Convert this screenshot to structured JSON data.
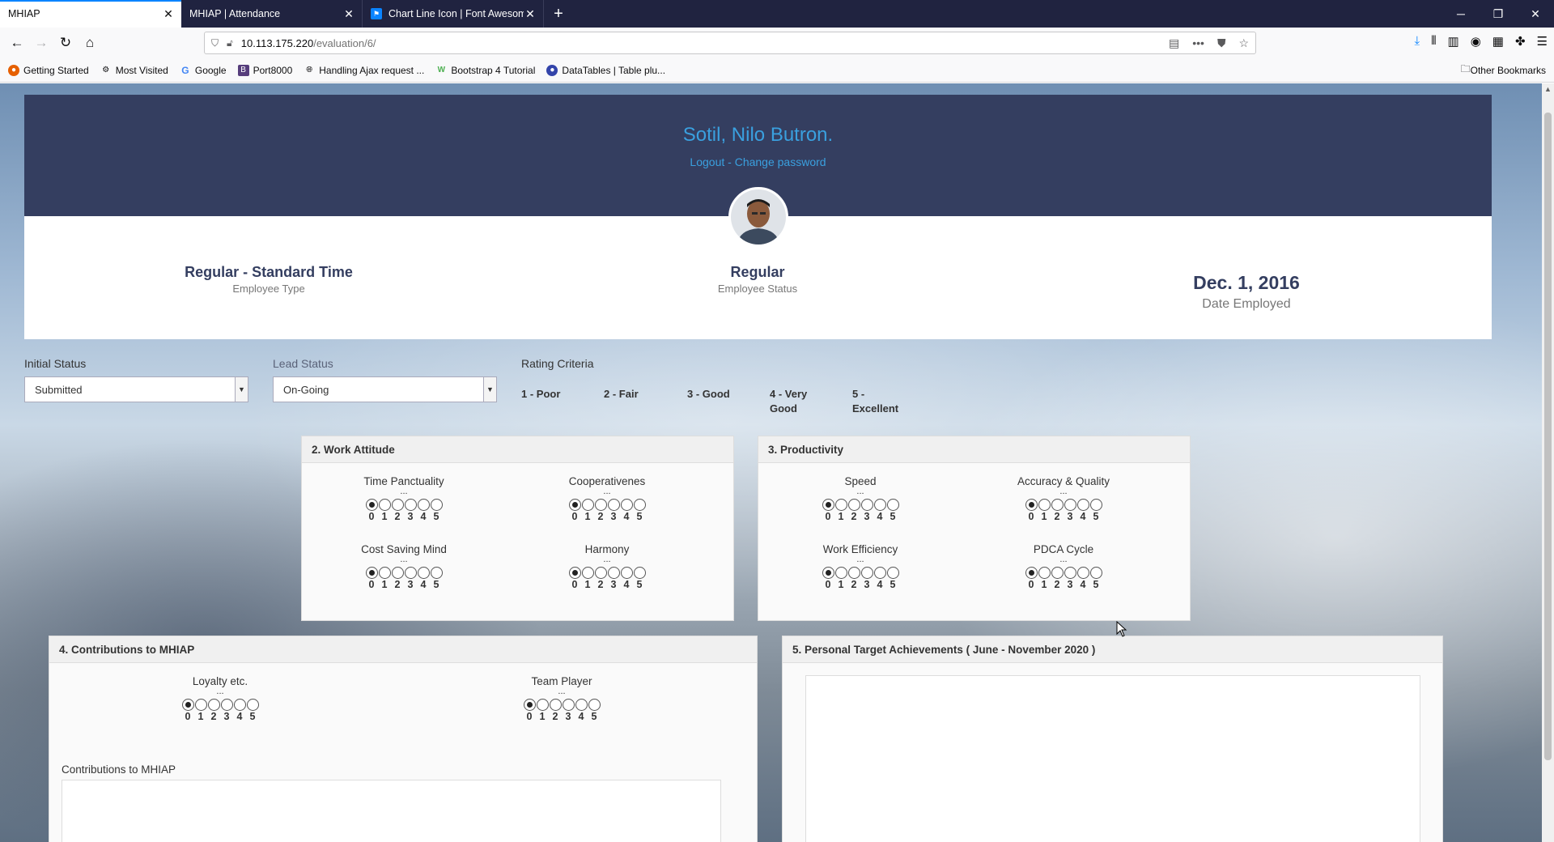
{
  "browser": {
    "tabs": [
      {
        "title": "MHIAP",
        "active": true
      },
      {
        "title": "MHIAP | Attendance",
        "active": false
      },
      {
        "title": "Chart Line Icon | Font Awesom",
        "active": false
      }
    ],
    "url_host": "10.113.175.220",
    "url_path": "/evaluation/6/",
    "bookmarks": [
      "Getting Started",
      "Most Visited",
      "Google",
      "Port8000",
      "Handling Ajax request ...",
      "Bootstrap 4 Tutorial",
      "DataTables | Table plu..."
    ],
    "other_bookmarks": "Other Bookmarks"
  },
  "header": {
    "employee_name": "Sotil, Nilo Butron.",
    "logout": "Logout",
    "separator": " - ",
    "change_password": "Change password"
  },
  "info": {
    "employee_type": "Regular - Standard Time",
    "employee_type_label": "Employee Type",
    "employee_status": "Regular",
    "employee_status_label": "Employee Status",
    "date_employed": "Dec. 1, 2016",
    "date_employed_label": "Date Employed"
  },
  "filters": {
    "initial_status_label": "Initial Status",
    "initial_status_value": "Submitted",
    "lead_status_label": "Lead Status",
    "lead_status_value": "On-Going"
  },
  "criteria": {
    "title": "Rating Criteria",
    "items": [
      "1 - Poor",
      "2 - Fair",
      "3 - Good",
      "4 - Very Good",
      "5 - Excellent"
    ]
  },
  "rating_scale": [
    "0",
    "1",
    "2",
    "3",
    "4",
    "5"
  ],
  "sections": {
    "work_attitude": {
      "title": "2. Work Attitude",
      "metrics": [
        {
          "name": "Time Panctuality",
          "dots": "...",
          "selected": 0
        },
        {
          "name": "Cooperativenes",
          "dots": "...",
          "selected": 0
        },
        {
          "name": "Cost Saving Mind",
          "dots": "...",
          "selected": 0
        },
        {
          "name": "Harmony",
          "dots": "...",
          "selected": 0
        }
      ]
    },
    "productivity": {
      "title": "3. Productivity",
      "metrics": [
        {
          "name": "Speed",
          "dots": "...",
          "selected": 0
        },
        {
          "name": "Accuracy & Quality",
          "dots": "...",
          "selected": 0
        },
        {
          "name": "Work Efficiency",
          "dots": "...",
          "selected": 0
        },
        {
          "name": "PDCA Cycle",
          "dots": "...",
          "selected": 0
        }
      ]
    },
    "contributions": {
      "title": "4. Contributions to MHIAP",
      "metrics": [
        {
          "name": "Loyalty etc.",
          "dots": "...",
          "selected": 0
        },
        {
          "name": "Team Player",
          "dots": "...",
          "selected": 0
        }
      ],
      "textarea_label": "Contributions to MHIAP"
    },
    "personal_target": {
      "title": "5. Personal Target Achievements ( June - November 2020 )"
    }
  },
  "colors": {
    "header_bg": "#343e60",
    "accent_link": "#3aa0df"
  }
}
